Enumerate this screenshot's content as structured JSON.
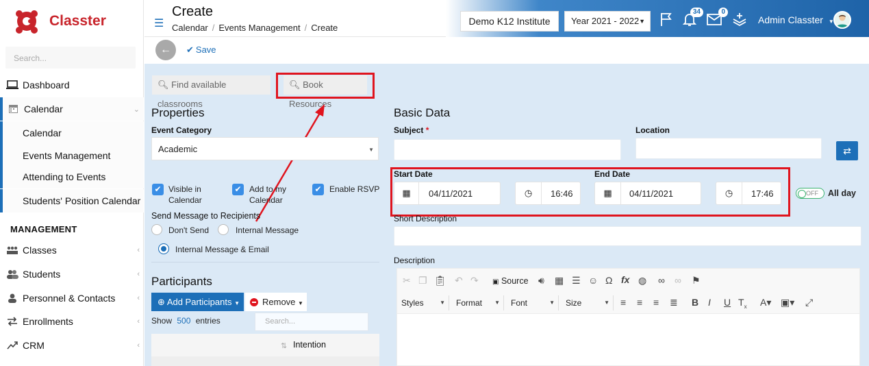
{
  "app": {
    "name": "Classter"
  },
  "sidebar": {
    "search_placeholder": "Search...",
    "items": [
      {
        "label": "Dashboard",
        "icon": "laptop-icon"
      },
      {
        "label": "Calendar",
        "icon": "calendar-icon"
      },
      {
        "label": "Calendar"
      },
      {
        "label": "Events Management"
      },
      {
        "label": "Attending to Events"
      },
      {
        "label": "Students' Position Calendar"
      }
    ],
    "section_label": "MANAGEMENT",
    "mgmt_items": [
      {
        "label": "Classes",
        "icon": "classes-icon"
      },
      {
        "label": "Students",
        "icon": "students-icon"
      },
      {
        "label": "Personnel & Contacts",
        "icon": "person-icon"
      },
      {
        "label": "Enrollments",
        "icon": "arrows-icon"
      },
      {
        "label": "CRM",
        "icon": "crm-icon"
      }
    ]
  },
  "header": {
    "title": "Create",
    "breadcrumb": [
      "Calendar",
      "Events Management",
      "Create"
    ],
    "institute": "Demo K12 Institute",
    "year": "Year 2021 - 2022",
    "notifications_count": "34",
    "messages_count": "0",
    "user": "Admin Classter"
  },
  "actions": {
    "save_label": "Save"
  },
  "tools": {
    "find_label": "Find available classrooms",
    "book_label": "Book Resources"
  },
  "properties": {
    "title": "Properties",
    "event_category_label": "Event Category",
    "event_category_value": "Academic",
    "visible_label": "Visible in Calendar",
    "add_label": "Add to my Calendar",
    "rsvp_label": "Enable RSVP",
    "send_label": "Send Message to Recipients",
    "radio_dont": "Don't Send",
    "radio_internal": "Internal Message",
    "radio_internal_email": "Internal Message & Email"
  },
  "participants": {
    "title": "Participants",
    "add_label": "Add Participants",
    "remove_label": "Remove",
    "show_label": "Show",
    "entries_count": "500",
    "entries_label": "entries",
    "search_placeholder": "Search...",
    "col_intention": "Intention"
  },
  "basic": {
    "title": "Basic Data",
    "subject_label": "Subject",
    "required_mark": "*",
    "location_label": "Location",
    "start_label": "Start Date",
    "start_date": "04/11/2021",
    "start_time": "16:46",
    "end_label": "End Date",
    "end_date": "04/11/2021",
    "end_time": "17:46",
    "toggle_label": "OFF",
    "allday_label": "All day",
    "short_desc_label": "Short Description",
    "desc_label": "Description"
  },
  "editor": {
    "source_label": "Source",
    "styles_label": "Styles",
    "format_label": "Format",
    "font_label": "Font",
    "size_label": "Size"
  },
  "colors": {
    "brand": "#c8242b",
    "primary": "#1d6fb8",
    "highlight": "#e0141e",
    "panel": "#dbe9f6"
  }
}
